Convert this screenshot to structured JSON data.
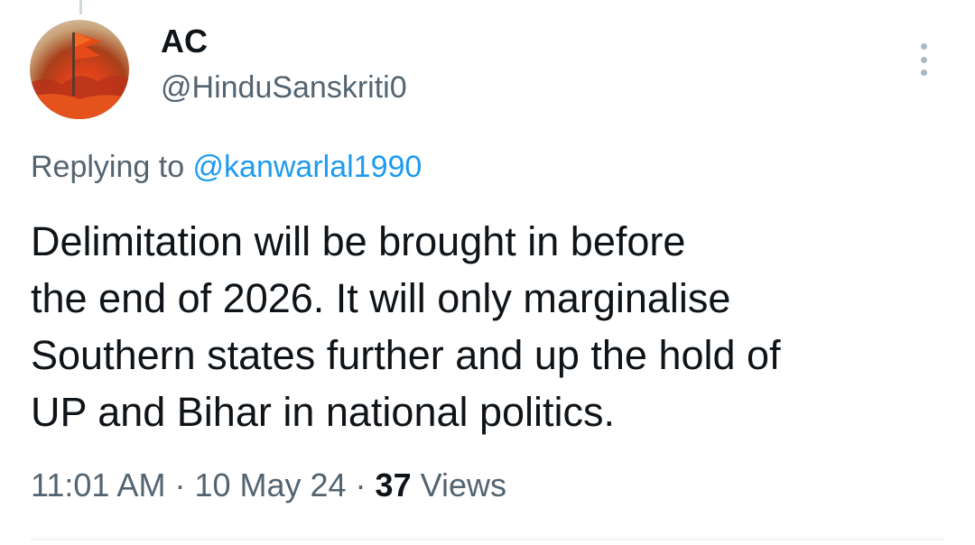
{
  "author": {
    "display_name": "AC",
    "handle": "@HinduSanskriti0",
    "avatar_icon": "saffron-flag-avatar"
  },
  "reply": {
    "prefix": "Replying to ",
    "handle": "@kanwarlal1990"
  },
  "tweet": {
    "lines": [
      "Delimitation will be brought in before",
      "the end of 2026. It will only marginalise",
      "Southern states further and up the hold of",
      "UP and Bihar in national politics."
    ]
  },
  "meta": {
    "time": "11:01 AM",
    "separator": " · ",
    "date": "10 May 24",
    "views_count": "37",
    "views_label": " Views"
  },
  "menu": {
    "icon": "more-vertical-icon"
  },
  "colors": {
    "text": "#0f1419",
    "secondary": "#536471",
    "link": "#1d9bf0",
    "divider": "#eff3f4"
  }
}
